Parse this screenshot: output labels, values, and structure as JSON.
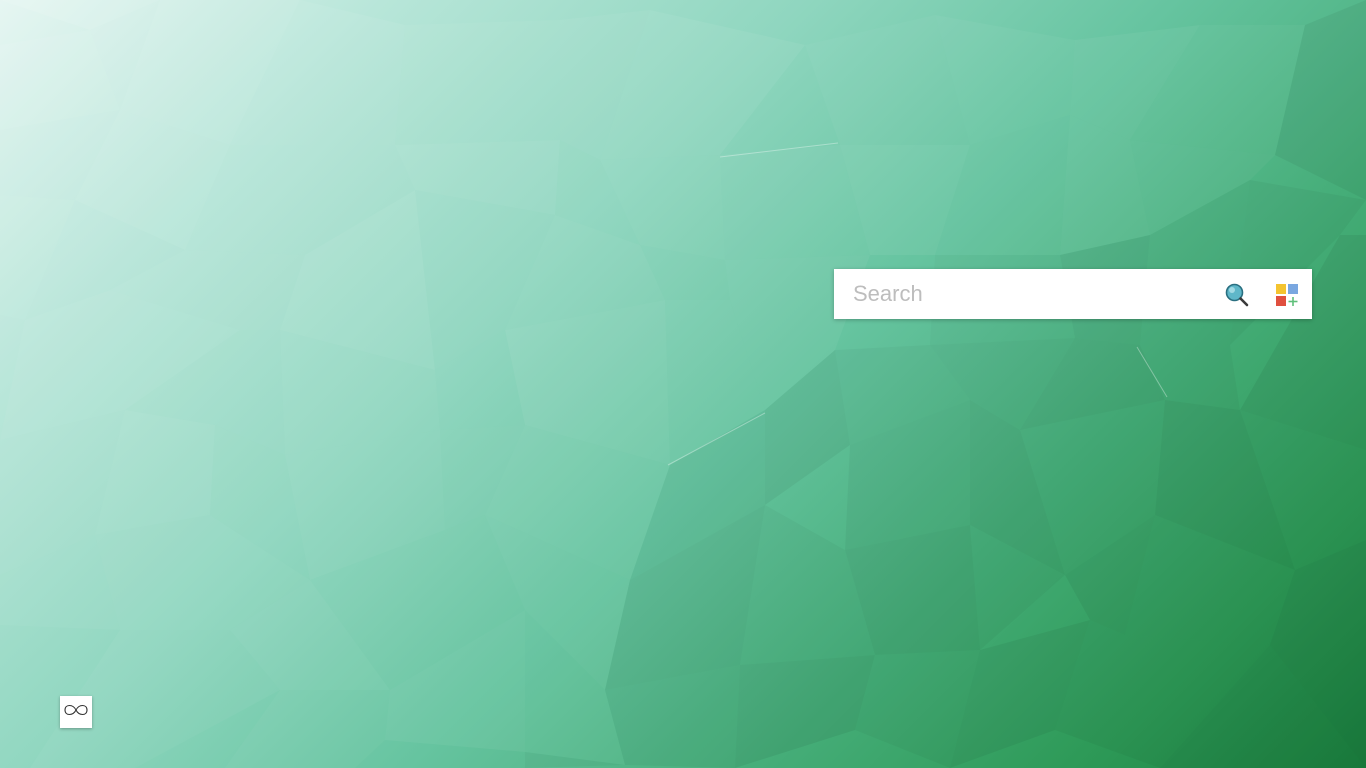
{
  "search": {
    "placeholder": "Search",
    "value": ""
  },
  "icons": {
    "search": "magnifier-icon",
    "apps": "apps-grid-icon",
    "infinity": "infinity-icon"
  },
  "colors": {
    "wallpaper_light": "#e6f6f2",
    "wallpaper_dark": "#1a803e",
    "apps_yellow": "#f4c430",
    "apps_blue": "#7aa7e0",
    "apps_red": "#e0503f",
    "apps_green": "#5fbf7a"
  }
}
